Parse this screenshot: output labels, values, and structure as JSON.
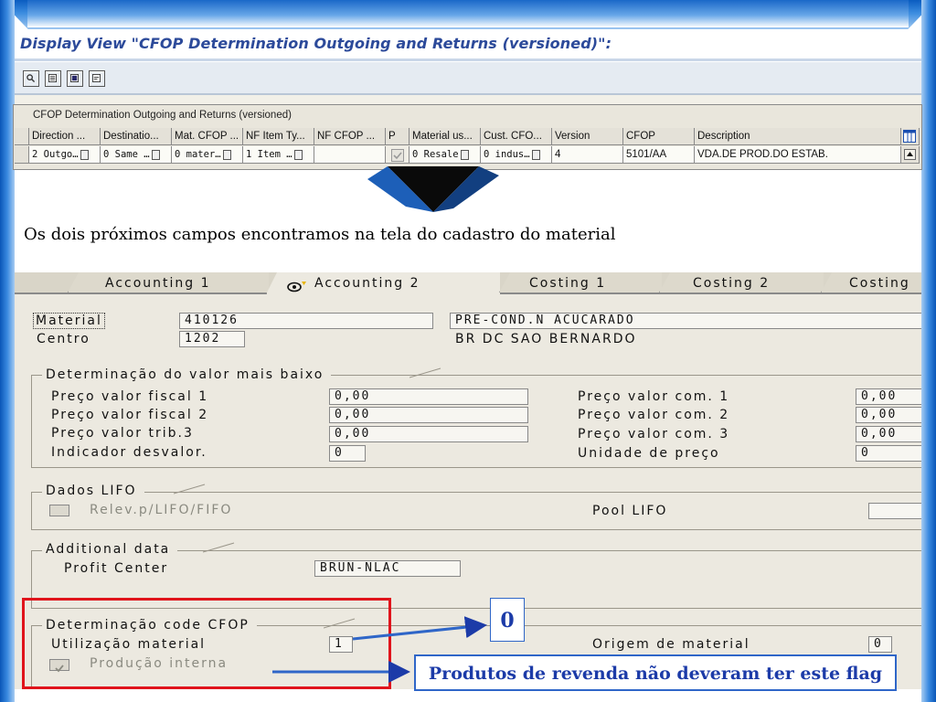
{
  "colors": {
    "frame_blue": "#1a68c8",
    "title_blue": "#2c4a9a",
    "highlight_red": "#e0141c",
    "annotation_blue": "#1c3ba8"
  },
  "window": {
    "title": "Display View \"CFOP Determination Outgoing and Returns (versioned)\":"
  },
  "toolbar": {
    "icons": [
      "details-icon",
      "select-all-icon",
      "select-block-icon",
      "deselect-icon"
    ]
  },
  "table": {
    "title": "CFOP Determination Outgoing and Returns (versioned)",
    "headers": [
      "Direction ...",
      "Destinatio...",
      "Mat. CFOP ...",
      "NF Item Ty...",
      "NF CFOP ...",
      "P",
      "Material us...",
      "Cust. CFO...",
      "Version",
      "CFOP",
      "Description"
    ],
    "row": [
      "2 Outgo…",
      "0 Same …",
      "0 mater…",
      "1 Item …",
      "",
      "",
      "0 Resale",
      "0 indus…",
      "4",
      "5101/AA",
      "VDA.DE PROD.DO ESTAB."
    ],
    "column_settings_icon": "table-settings-icon",
    "scroll_up_icon": "scroll-up-icon"
  },
  "caption": "Os dois próximos campos encontramos na tela do cadastro do material",
  "tabs": [
    "Accounting 1",
    "Accounting 2",
    "Costing 1",
    "Costing 2",
    "Costing"
  ],
  "material_header": {
    "material_label": "Material",
    "material_value": "410126",
    "material_desc": "PRE-COND.N ACUCARADO",
    "plant_label": "Centro",
    "plant_value": "1202",
    "plant_desc": "BR DC SAO BERNARDO"
  },
  "lowest_value": {
    "title": "Determinação do valor mais baixo",
    "fields": [
      {
        "label": "Preço valor fiscal 1",
        "value": "0,00"
      },
      {
        "label": "Preço valor fiscal 2",
        "value": "0,00"
      },
      {
        "label": "Preço valor trib.3",
        "value": "0,00"
      },
      {
        "label": "Indicador desvalor.",
        "value": "0"
      }
    ],
    "right_fields": [
      {
        "label": "Preço valor com. 1",
        "value": "0,00"
      },
      {
        "label": "Preço valor com. 2",
        "value": "0,00"
      },
      {
        "label": "Preço valor com. 3",
        "value": "0,00"
      },
      {
        "label": "Unidade de preço",
        "value": "0"
      }
    ]
  },
  "lifo": {
    "title": "Dados LIFO",
    "checkbox_label": "Relev.p/LIFO/FIFO",
    "pool_label": "Pool LIFO",
    "pool_value": ""
  },
  "additional": {
    "title": "Additional data",
    "profit_center_label": "Profit Center",
    "profit_center_value": "BRUN-NLAC"
  },
  "cfop": {
    "title": "Determinação code CFOP",
    "usage_label": "Utilização material",
    "usage_value": "1",
    "origin_label": "Origem de material",
    "origin_value": "0",
    "inhouse_label": "Produção interna",
    "inhouse_checked": true
  },
  "annotations": {
    "zero": "0",
    "note": "Produtos de revenda não deveram ter este flag"
  }
}
